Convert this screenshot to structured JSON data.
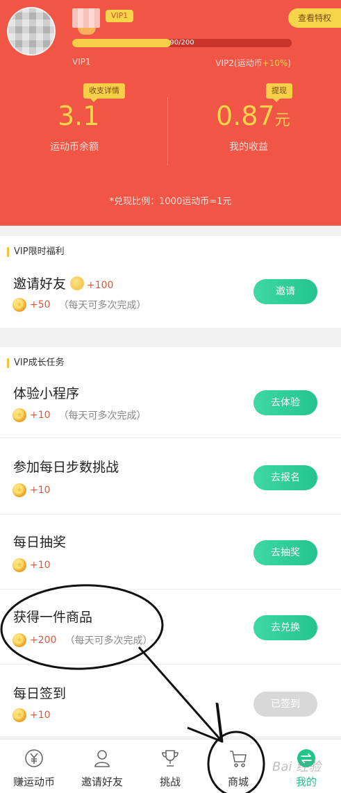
{
  "header": {
    "vip_tag": "VIP1",
    "privilege_button": "查看特权",
    "progress": {
      "text": "90/200",
      "fraction": 0.45
    },
    "vip_current": "VIP1",
    "vip_next_prefix": "VIP2(运动币",
    "vip_next_bonus": "+10%",
    "vip_next_suffix": ")",
    "detail_badge": "收支详情",
    "cash_badge": "提现",
    "balance_value": "3.1",
    "balance_label": "运动币余额",
    "income_value": "0.87",
    "income_unit": "元",
    "income_label": "我的收益",
    "exchange_note": "*兑现比例：1000运动币=1元"
  },
  "benefit": {
    "title": "VIP限时福利",
    "tasks": [
      {
        "title": "邀请好友",
        "title_bonus": "+100",
        "reward": "+50",
        "note": "（每天可多次完成）",
        "button": "邀请"
      }
    ]
  },
  "growth": {
    "title": "VIP成长任务",
    "tasks": [
      {
        "title": "体验小程序",
        "reward": "+10",
        "note": "（每天可多次完成）",
        "button": "去体验"
      },
      {
        "title": "参加每日步数挑战",
        "reward": "+10",
        "note": "",
        "button": "去报名"
      },
      {
        "title": "每日抽奖",
        "reward": "+10",
        "note": "",
        "button": "去抽奖"
      },
      {
        "title": "获得一件商品",
        "reward": "+200",
        "note": "（每天可多次完成）",
        "button": "去兑换"
      },
      {
        "title": "每日签到",
        "reward": "+10",
        "note": "",
        "button": "已签到"
      }
    ]
  },
  "nav": {
    "items": [
      {
        "label": "赚运动币",
        "icon": "yen-coin-icon"
      },
      {
        "label": "邀请好友",
        "icon": "person-icon"
      },
      {
        "label": "挑战",
        "icon": "trophy-icon"
      },
      {
        "label": "商城",
        "icon": "cart-icon"
      },
      {
        "label": "我的",
        "icon": "swap-icon"
      }
    ],
    "active_index": 4
  },
  "watermark": "Bai 经验",
  "colors": {
    "header_bg": "#f05545",
    "gold": "#f7d54a",
    "button_green": "#24c48e",
    "disabled_gray": "#d8d8d8",
    "reward_red": "#d8573b"
  }
}
